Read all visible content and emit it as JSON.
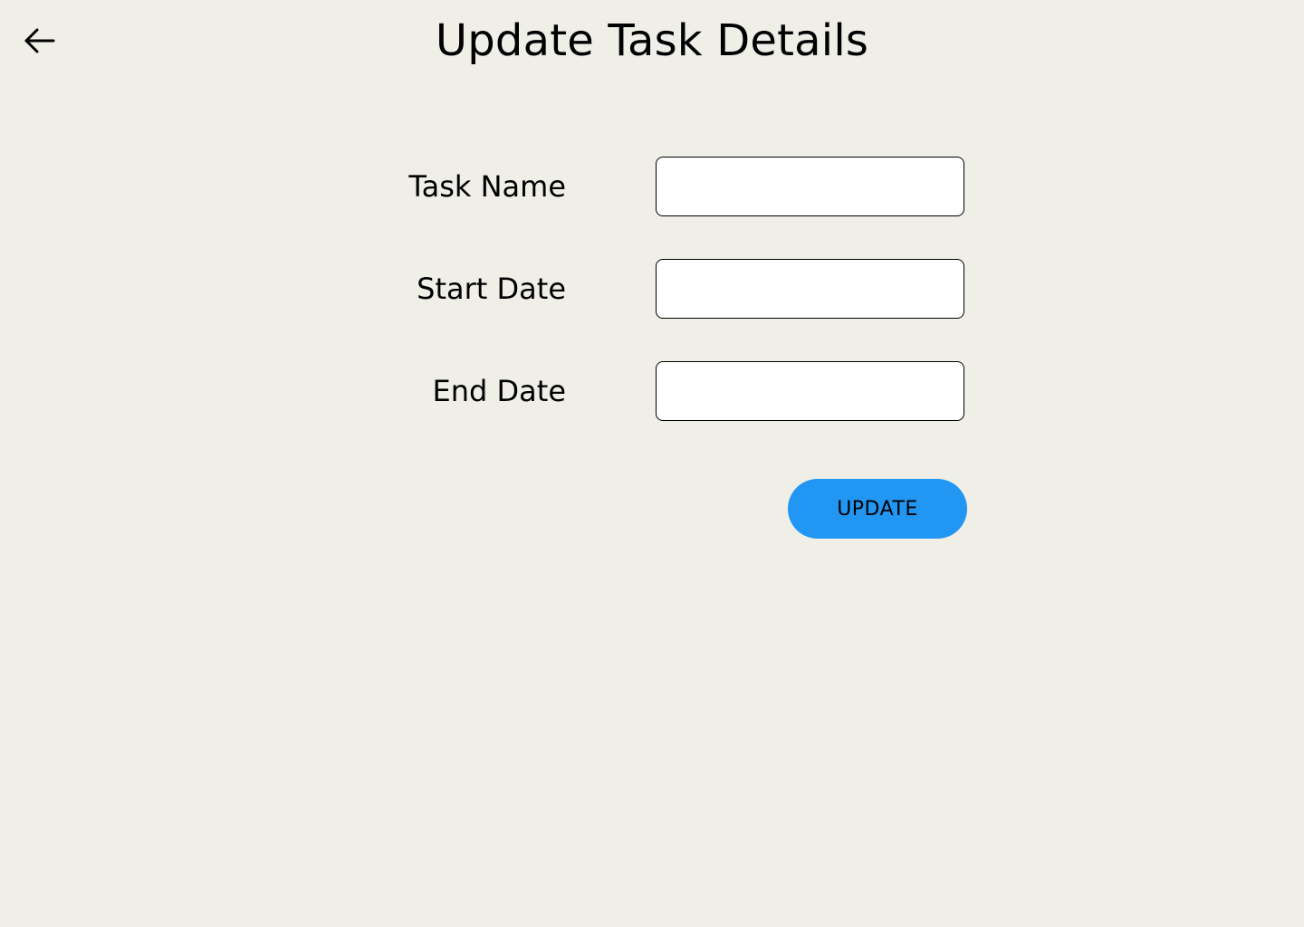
{
  "header": {
    "title": "Update Task Details",
    "back_icon": "arrow-left-icon"
  },
  "form": {
    "fields": [
      {
        "label": "Task Name",
        "value": "",
        "placeholder": ""
      },
      {
        "label": "Start Date",
        "value": "",
        "placeholder": ""
      },
      {
        "label": "End Date",
        "value": "",
        "placeholder": ""
      }
    ],
    "submit_label": "UPDATE"
  },
  "colors": {
    "background": "#EFEEE7",
    "accent": "#2196F3",
    "input_background": "#FFFFFF",
    "text": "#000000"
  }
}
